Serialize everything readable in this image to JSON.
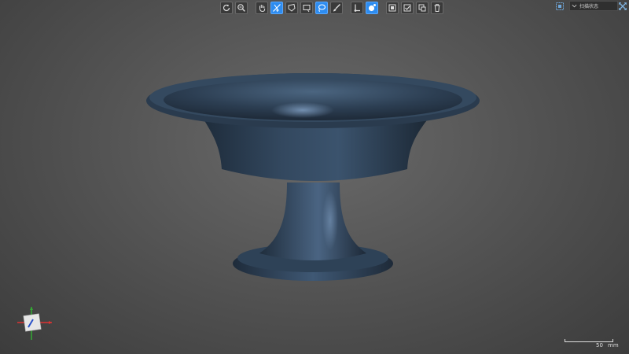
{
  "toolbar": {
    "buttons": [
      {
        "icon": "rotate-icon",
        "active": false
      },
      {
        "icon": "zoom-fit-icon",
        "active": false
      },
      {
        "icon": "pan-hand-icon",
        "active": false
      },
      {
        "icon": "no-selection-icon",
        "active": true
      },
      {
        "icon": "polygon-select-icon",
        "active": false
      },
      {
        "icon": "rectangle-select-icon",
        "active": false
      },
      {
        "icon": "lasso-select-icon",
        "active": true
      },
      {
        "icon": "brush-select-icon",
        "active": false
      },
      {
        "icon": "line-select-icon",
        "active": false
      },
      {
        "icon": "sphere-select-icon",
        "active": true
      },
      {
        "icon": "select-all-icon",
        "active": false
      },
      {
        "icon": "invert-select-icon",
        "active": false
      },
      {
        "icon": "connected-select-icon",
        "active": false
      },
      {
        "icon": "delete-icon",
        "active": false
      }
    ]
  },
  "panel": {
    "title": "扫描状态"
  },
  "scale": {
    "value": "50",
    "unit": "mm"
  },
  "colors": {
    "active": "#2d8cf0",
    "model": "#2f4256",
    "background": "#555555"
  }
}
